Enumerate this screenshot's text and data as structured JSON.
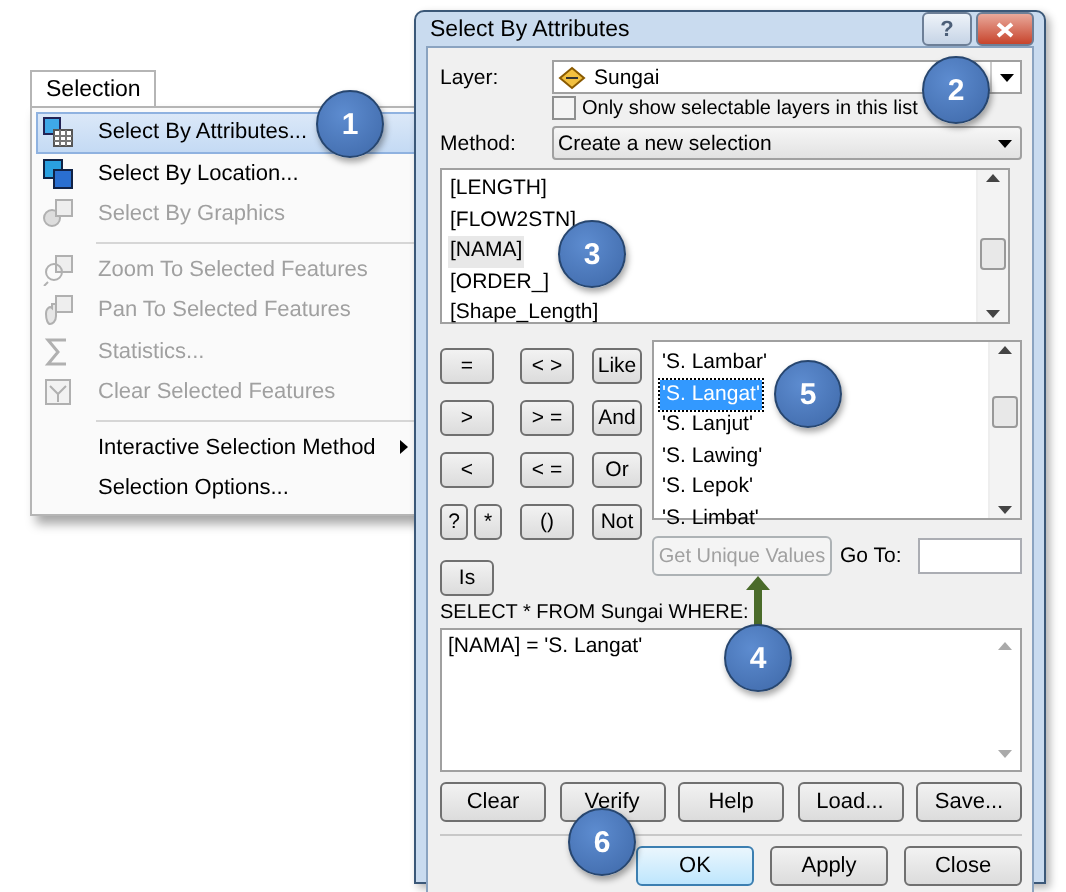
{
  "menu": {
    "tab": "Selection",
    "groups": [
      [
        {
          "label": "Select By Attributes...",
          "selected": true,
          "disabled": false,
          "submenu": false
        },
        {
          "label": "Select By Location...",
          "selected": false,
          "disabled": false,
          "submenu": false
        },
        {
          "label": "Select By Graphics",
          "selected": false,
          "disabled": true,
          "submenu": false
        }
      ],
      [
        {
          "label": "Zoom To Selected Features",
          "selected": false,
          "disabled": true,
          "submenu": false
        },
        {
          "label": "Pan To Selected Features",
          "selected": false,
          "disabled": true,
          "submenu": false
        },
        {
          "label": "Statistics...",
          "selected": false,
          "disabled": true,
          "submenu": false
        },
        {
          "label": "Clear Selected Features",
          "selected": false,
          "disabled": true,
          "submenu": false
        }
      ],
      [
        {
          "label": "Interactive Selection Method",
          "selected": false,
          "disabled": false,
          "submenu": true
        },
        {
          "label": "Selection Options...",
          "selected": false,
          "disabled": false,
          "submenu": false
        }
      ]
    ]
  },
  "dialog": {
    "title": "Select By Attributes",
    "title_buttons": [
      "?"
    ],
    "layer": {
      "label": "Layer:",
      "value": "Sungai"
    },
    "selectable_only": {
      "label": "Only show selectable layers in this list",
      "checked": false
    },
    "method": {
      "label": "Method:",
      "value": "Create a new selection"
    },
    "fields": [
      {
        "label": "[LENGTH]",
        "selected": false
      },
      {
        "label": "[FLOW2STN]",
        "selected": false
      },
      {
        "label": "[NAMA]",
        "selected": true
      },
      {
        "label": "[ORDER_]",
        "selected": false
      },
      {
        "label": "[Shape_Length]",
        "selected": false
      }
    ],
    "operator_rows": [
      [
        "=",
        "< >",
        "Like"
      ],
      [
        ">",
        "> =",
        "And"
      ],
      [
        "<",
        "< =",
        "Or"
      ],
      [
        "?",
        "*",
        "()",
        "Not"
      ],
      [
        "Is"
      ]
    ],
    "values": [
      {
        "label": "'S. Lambar'",
        "selected": false
      },
      {
        "label": "'S. Langat'",
        "selected": true
      },
      {
        "label": "'S. Lanjut'",
        "selected": false
      },
      {
        "label": "'S. Lawing'",
        "selected": false
      },
      {
        "label": "'S. Lepok'",
        "selected": false
      },
      {
        "label": "'S. Limbat'",
        "selected": false
      }
    ],
    "unique_values_button": {
      "label": "Get Unique Values",
      "disabled": true
    },
    "goto_label": "Go To:",
    "sql_label": "SELECT * FROM Sungai WHERE:",
    "expression": "[NAMA] = 'S. Langat'",
    "buttons": [
      "Clear",
      "Verify",
      "Help",
      "Load...",
      "Save..."
    ],
    "footer_buttons": [
      {
        "label": "OK",
        "default": true
      },
      {
        "label": "Apply",
        "default": false
      },
      {
        "label": "Close",
        "default": false
      }
    ]
  },
  "callouts": [
    "1",
    "2",
    "3",
    "4",
    "5",
    "6"
  ]
}
